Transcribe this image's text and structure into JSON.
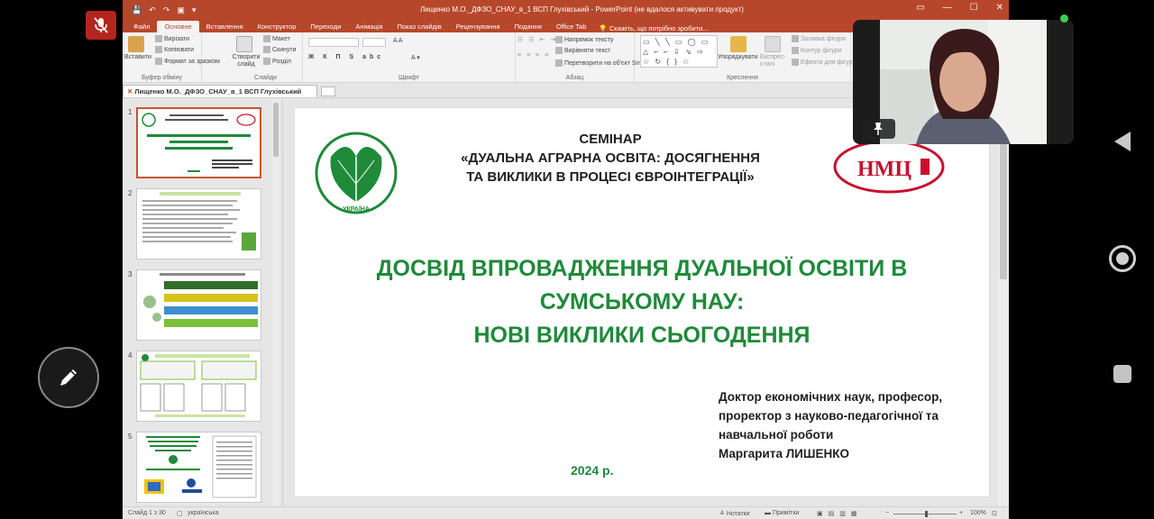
{
  "powerpoint": {
    "window_title": "Лищенко М.О._ДФЗО_СНАУ_в_1  ВСП Глухівський - PowerPoint (не вдалося активувати продукт)",
    "tabs": [
      {
        "label": "Файл"
      },
      {
        "label": "Основне"
      },
      {
        "label": "Вставлення"
      },
      {
        "label": "Конструктор"
      },
      {
        "label": "Переходи"
      },
      {
        "label": "Анімація"
      },
      {
        "label": "Показ слайдів"
      },
      {
        "label": "Рецензування"
      },
      {
        "label": "Подання"
      },
      {
        "label": "Office Tab"
      }
    ],
    "tell_me": "Скажіть, що потрібно зробити...",
    "ribbon": {
      "paste": "Вставити",
      "cut": "Вирізати",
      "copy": "Копіювати",
      "format_painter": "Формат за зразком",
      "clipboard_group": "Буфер обміну",
      "new_slide": "Створити слайд",
      "layout": "Макет",
      "reset": "Скинути",
      "section": "Розділ",
      "slides_group": "Слайди",
      "font_group": "Шрифт",
      "text_direction": "Напрямок тексту",
      "align_text": "Вирівняти текст",
      "convert_smartart": "Перетворити на об'єкт SmartArt",
      "paragraph_group": "Абзац",
      "arrange": "Упорядкувати",
      "quick_styles": "Експрес-стилі",
      "shape_fill": "Заливка фігури",
      "shape_outline": "Контур фігури",
      "shape_effects": "Ефекти для фігур",
      "drawing_group": "Креслення",
      "shapes_preview": "▭ ╲ ╲ ▭ ◯ ▭ △ ⌐ ⌐ ⇩ ⇘ ⇨ ☆ ↻ { } ☆"
    },
    "doc_tab": "Лищенко М.О._ДФЗО_СНАУ_в_1  ВСП Глухівський",
    "thumbnails": [
      {
        "num": "1",
        "title": "ДОСВІД ВПРОВАДЖЕННЯ ДУАЛЬНОЇ ОСВІТИ В СУМСЬКОМУ НАУ: НОВІ ВИКЛИКИ СЬОГОДЕННЯ"
      },
      {
        "num": "2",
        "title": "НОРМАТИВНЕ ЗАБЕЗПЕЧЕННЯ ДУАЛЬНОЇ ОСВІТИ В УКРАЇНІ"
      },
      {
        "num": "3",
        "title": "ПЕРЕВАГИ ДУАЛЬНОЇ АГРАРНОЇ ОСВІТИ ДЛЯ СУМСЬКОГО НАУ"
      },
      {
        "num": "4",
        "title": "СПІВПРАЦЯ З АГРОПІДПРИЄМСТВАМИ"
      },
      {
        "num": "5",
        "title": "МІЖНАРОДНА СПІВПРАЦЯ"
      }
    ],
    "slide": {
      "seminar_label": "СЕМІНАР",
      "seminar_title_line1": "«ДУАЛЬНА АГРАРНА ОСВІТА: ДОСЯГНЕННЯ",
      "seminar_title_line2": "ТА ВИКЛИКИ В ПРОЦЕСІ ЄВРОІНТЕГРАЦІЇ»",
      "title_line1": "ДОСВІД ВПРОВАДЖЕННЯ ДУАЛЬНОЇ ОСВІТИ В",
      "title_line2": "СУМСЬКОМУ НАУ:",
      "title_line3": "НОВІ ВИКЛИКИ СЬОГОДЕННЯ",
      "author_line1": "Доктор економічних наук, професор,",
      "author_line2": "проректор з науково-педагогічної та",
      "author_line3": "навчальної роботи",
      "author_line4": "Маргарита ЛИШЕНКО",
      "year": "2024 р.",
      "logo_right_text": "НМЦ",
      "logo_left_text": "УКРАЇНА"
    },
    "status": {
      "slide_counter": "Слайд 1 з 30",
      "language": "українська",
      "notes": "Нотатки",
      "comments": "Примітки",
      "zoom": "100%"
    }
  },
  "colors": {
    "ppt_accent": "#b7472a",
    "slide_green": "#1e8a3a",
    "nmc_red": "#c8102e"
  }
}
